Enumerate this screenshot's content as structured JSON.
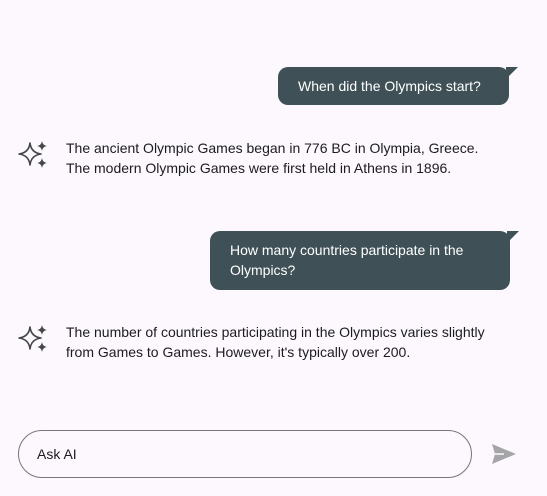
{
  "conversation": {
    "messages": [
      {
        "role": "user",
        "text": "When did the Olympics start?"
      },
      {
        "role": "assistant",
        "text": "The ancient Olympic Games began in 776 BC in Olympia, Greece.  The modern Olympic Games were first held in Athens in 1896."
      },
      {
        "role": "user",
        "text": "How many countries participate in the Olympics?"
      },
      {
        "role": "assistant",
        "text": "The number of countries participating in the Olympics varies slightly from Games to Games.  However, it's typically over 200."
      }
    ]
  },
  "composer": {
    "placeholder": "Ask AI",
    "value": ""
  },
  "icons": {
    "assistant_avatar": "sparkle-icon",
    "send": "send-icon"
  },
  "colors": {
    "background": "#fcf8fd",
    "user_bubble": "#3f5157",
    "user_text": "#ffffff",
    "assistant_text": "#1c1b1f",
    "send_icon": "#a5a5a8"
  }
}
